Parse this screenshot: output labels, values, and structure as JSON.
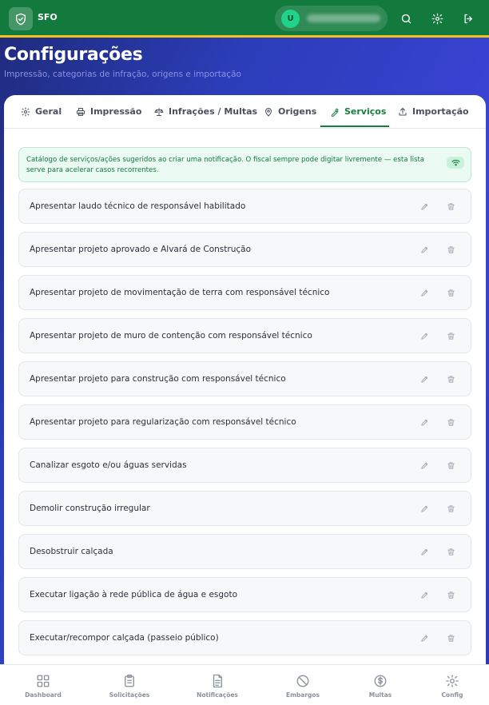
{
  "app": {
    "name": "SFO",
    "user_initial": "U"
  },
  "header": {
    "title": "Configurações",
    "subtitle": "Impressão, categorias de infração, origens e importação"
  },
  "tabs": [
    {
      "label": "Geral",
      "icon": "gear-icon"
    },
    {
      "label": "Impressão",
      "icon": "printer-icon"
    },
    {
      "label": "Infrações / Multas",
      "icon": "scale-icon"
    },
    {
      "label": "Origens",
      "icon": "map-pin-icon"
    },
    {
      "label": "Serviços",
      "icon": "wrench-icon",
      "active": true
    },
    {
      "label": "Importação",
      "icon": "upload-icon"
    }
  ],
  "notice": {
    "text": "Catálogo de serviços/ações sugeridos ao criar uma notificação. O fiscal sempre pode digitar livremente — esta lista serve para acelerar casos recorrentes."
  },
  "services": [
    "Apresentar laudo técnico de responsável habilitado",
    "Apresentar projeto aprovado e Alvará de Construção",
    "Apresentar projeto de movimentação de terra com responsável técnico",
    "Apresentar projeto de muro de contenção com responsável técnico",
    "Apresentar projeto para construção com responsável técnico",
    "Apresentar projeto para regularização com responsável técnico",
    "Canalizar esgoto e/ou águas servidas",
    "Demolir construção irregular",
    "Desobstruir calçada",
    "Executar ligação à rede pública de água e esgoto",
    "Executar/recompor calçada (passeio público)"
  ],
  "nav": [
    {
      "label": "Dashboard",
      "icon": "dashboard-icon"
    },
    {
      "label": "Solicitações",
      "icon": "clipboard-icon"
    },
    {
      "label": "Notificações",
      "icon": "document-icon"
    },
    {
      "label": "Embargos",
      "icon": "ban-icon"
    },
    {
      "label": "Multas",
      "icon": "dollar-icon"
    },
    {
      "label": "Config",
      "icon": "gear-icon",
      "active": true
    }
  ],
  "colors": {
    "primary_green": "#137a3e",
    "accent_yellow": "#f4c21a",
    "active_tab": "#14803f"
  }
}
